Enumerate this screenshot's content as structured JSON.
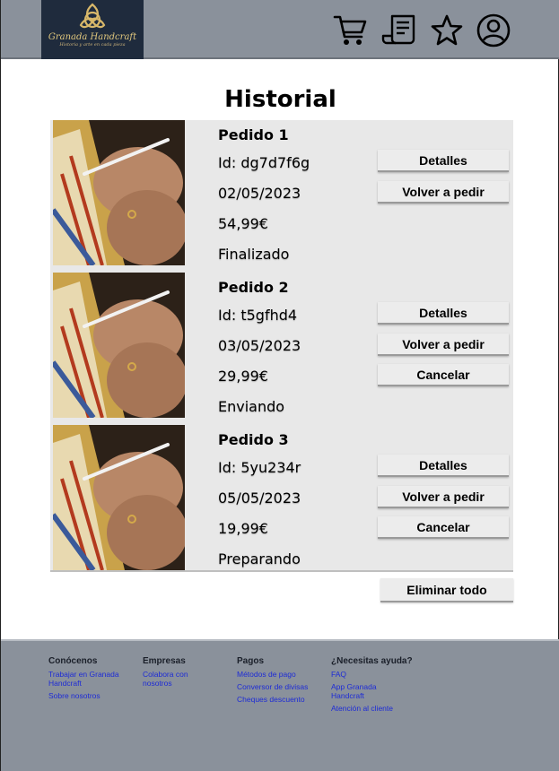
{
  "header": {
    "logo": {
      "brand": "Granada Handcraft",
      "tagline": "Historia y arte en cada pieza"
    },
    "icons": [
      "cart-icon",
      "receipt-icon",
      "star-icon",
      "user-icon"
    ]
  },
  "page": {
    "title": "Historial"
  },
  "orders": [
    {
      "title": "Pedido 1",
      "id": "Id: dg7d7f6g",
      "date": "02/05/2023",
      "price": "54,99€",
      "status": "Finalizado",
      "buttons": [
        "Detalles",
        "Volver a pedir"
      ]
    },
    {
      "title": "Pedido 2",
      "id": "Id: t5gfhd4",
      "date": "03/05/2023",
      "price": "29,99€",
      "status": "Enviando",
      "buttons": [
        "Detalles",
        "Volver a pedir",
        "Cancelar"
      ]
    },
    {
      "title": "Pedido 3",
      "id": "Id: 5yu234r",
      "date": "05/05/2023",
      "price": "19,99€",
      "status": "Preparando",
      "buttons": [
        "Detalles",
        "Volver a pedir",
        "Cancelar"
      ]
    }
  ],
  "actions": {
    "clear_all": "Eliminar todo"
  },
  "footer": {
    "columns": [
      {
        "heading": "Conócenos",
        "links": [
          "Trabajar en Granada Handcraft",
          "Sobre nosotros"
        ]
      },
      {
        "heading": "Empresas",
        "links": [
          "Colabora con nosotros"
        ]
      },
      {
        "heading": "Pagos",
        "links": [
          "Métodos de pago",
          "Conversor de divisas",
          "Cheques descuento"
        ]
      },
      {
        "heading": "¿Necesitas ayuda?",
        "links": [
          "FAQ",
          "App Granada Handcraft",
          "Atención al cliente"
        ]
      }
    ]
  },
  "colors": {
    "header_bg": "#8a919b",
    "panel_bg": "#e8e8e8",
    "link": "#1d2bd6",
    "logo_bg": "#1f2b3d",
    "logo_gold": "#d8b86a"
  }
}
